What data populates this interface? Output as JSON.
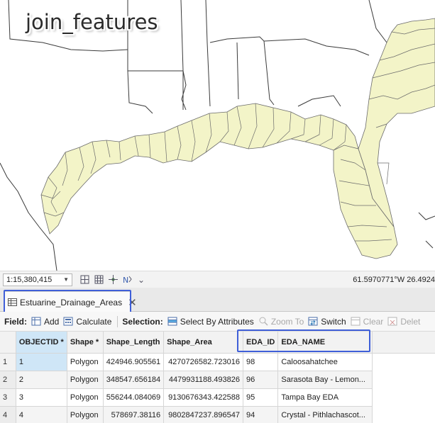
{
  "map": {
    "layer_title": "join_features",
    "polygon_fill": "#f3f4c8",
    "polygon_stroke": "#6b6b6b",
    "boundary_stroke": "#3a3a3a"
  },
  "statusbar": {
    "scale": "1:15,380,415",
    "coords": "61.5970771°W 26.4924"
  },
  "tab": {
    "label": "Estuarine_Drainage_Areas",
    "close": "✕"
  },
  "toolbar": {
    "field_label": "Field:",
    "add_label": "Add",
    "calculate_label": "Calculate",
    "selection_label": "Selection:",
    "select_by_attr_label": "Select By Attributes",
    "zoom_to_label": "Zoom To",
    "switch_label": "Switch",
    "clear_label": "Clear",
    "delete_label": "Delet"
  },
  "table": {
    "columns": [
      "",
      "OBJECTID *",
      "Shape *",
      "Shape_Length",
      "Shape_Area",
      "EDA_ID",
      "EDA_NAME"
    ],
    "rows": [
      [
        "1",
        "1",
        "Polygon",
        "424946.905561",
        "4270726582.723016",
        "98",
        "Caloosahatchee"
      ],
      [
        "2",
        "2",
        "Polygon",
        "348547.656184",
        "4479931188.493826",
        "96",
        "Sarasota Bay - Lemon..."
      ],
      [
        "3",
        "3",
        "Polygon",
        "556244.084069",
        "9130676343.422588",
        "95",
        "Tampa Bay EDA"
      ],
      [
        "4",
        "4",
        "Polygon",
        "578697.38116",
        "9802847237.896547",
        "94",
        "Crystal - Pithlachascot..."
      ]
    ]
  },
  "colors": {
    "highlight_outline": "#3f5fd8",
    "selected_cell": "#cfe6f7"
  }
}
